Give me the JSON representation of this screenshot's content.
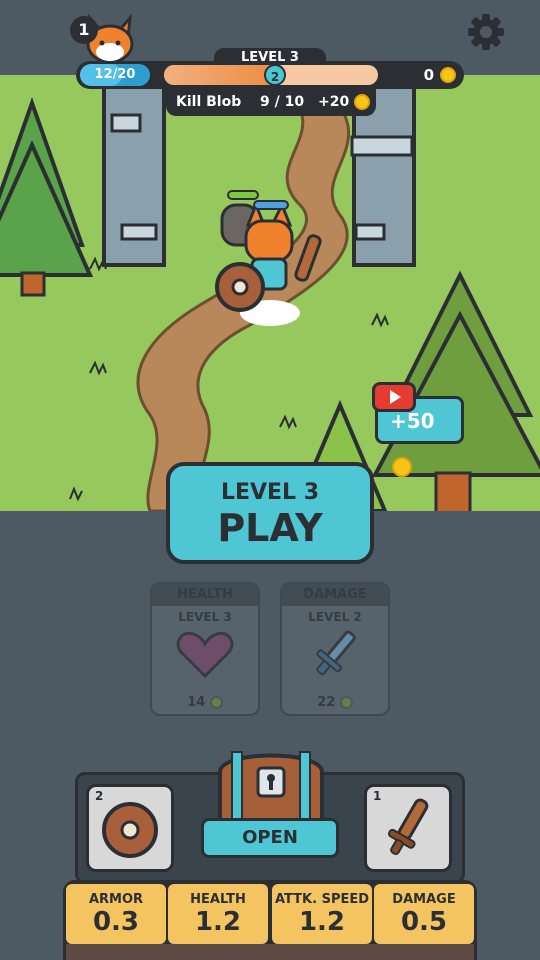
{
  "player": {
    "level_badge": "1",
    "avatar": "fox-face-icon",
    "xp_text": "12/20",
    "xp_fraction": 0.6
  },
  "level_progress": {
    "label": "LEVEL 3",
    "node": "2",
    "fraction": 0.5
  },
  "coins": "0",
  "quest": {
    "name": "Kill Blob",
    "progress": "9 / 10",
    "reward": "+20"
  },
  "ad_reward": {
    "amount": "+50",
    "icon": "video-ad-icon"
  },
  "play_button": {
    "line1": "LEVEL 3",
    "line2": "PLAY"
  },
  "upgrades": [
    {
      "title": "HEALTH",
      "level": "LEVEL 3",
      "cost": "14",
      "icon": "heart-icon"
    },
    {
      "title": "DAMAGE",
      "level": "LEVEL 2",
      "cost": "22",
      "icon": "sword-icon"
    }
  ],
  "equipment": {
    "armor_count": "2",
    "weapon_count": "1",
    "open_label": "OPEN"
  },
  "stats": [
    {
      "name": "ARMOR",
      "value": "0.3"
    },
    {
      "name": "HEALTH",
      "value": "1.2"
    },
    {
      "name": "ATTK. SPEED",
      "value": "1.2"
    },
    {
      "name": "DAMAGE",
      "value": "0.5"
    }
  ],
  "colors": {
    "accent": "#4ec6d4",
    "grass": "#96c85e",
    "panel": "#4d5963",
    "stat_bg": "#f4c461"
  }
}
